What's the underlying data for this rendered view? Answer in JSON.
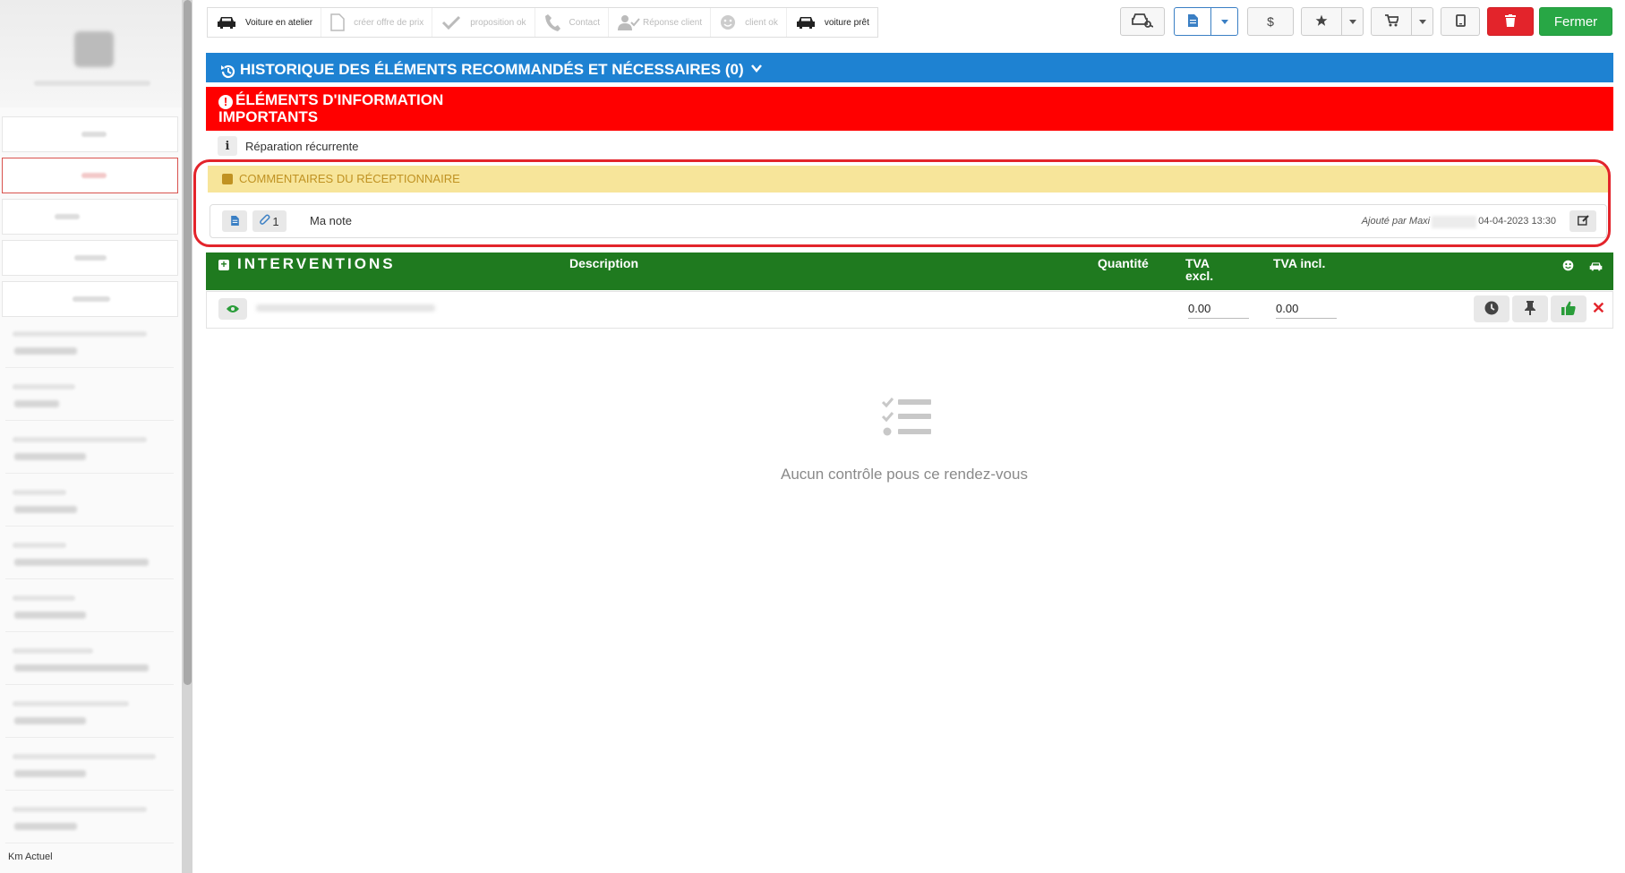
{
  "sidebar": {
    "km_label": "Km Actuel"
  },
  "toolbar": {
    "steps": [
      {
        "label": "Voiture en atelier",
        "done": true,
        "icon": "car-icon"
      },
      {
        "label": "créer offre de prix",
        "done": false,
        "icon": "document-icon"
      },
      {
        "label": "proposition ok",
        "done": false,
        "icon": "check-icon"
      },
      {
        "label": "Contact",
        "done": false,
        "icon": "phone-icon"
      },
      {
        "label": "Réponse client",
        "done": false,
        "icon": "user-check-icon"
      },
      {
        "label": "client ok",
        "done": false,
        "icon": "smile-icon"
      },
      {
        "label": "voiture prêt",
        "done": true,
        "icon": "car-icon"
      }
    ],
    "dollar_label": "$",
    "close_label": "Fermer"
  },
  "history": {
    "title": "HISTORIQUE DES ÉLÉMENTS RECOMMANDÉS ET NÉCESSAIRES (0)"
  },
  "important": {
    "title": "ÉLÉMENTS D'INFORMATION IMPORTANTS",
    "items": [
      {
        "label": "Réparation récurrente"
      }
    ]
  },
  "comments": {
    "title": "COMMENTAIRES DU RÉCEPTIONNAIRE",
    "note": {
      "attachments": "1",
      "text": "Ma note",
      "added_by": "Ajouté par Maxi",
      "date": "04-04-2023 13:30"
    }
  },
  "interventions": {
    "title": "INTERVENTIONS",
    "columns": {
      "description": "Description",
      "quantity": "Quantité",
      "tva_excl": "TVA excl.",
      "tva_incl": "TVA incl."
    },
    "rows": [
      {
        "tva_excl": "0.00",
        "tva_incl": "0.00"
      }
    ]
  },
  "empty_state": {
    "text": "Aucun contrôle pous ce rendez-vous"
  },
  "colors": {
    "history_blue": "#1e82d2",
    "important_red": "#ff0000",
    "comments_yellow": "#f7e59a",
    "interventions_green": "#1f7a1f",
    "close_green": "#28a745",
    "delete_red": "#e3242b"
  }
}
